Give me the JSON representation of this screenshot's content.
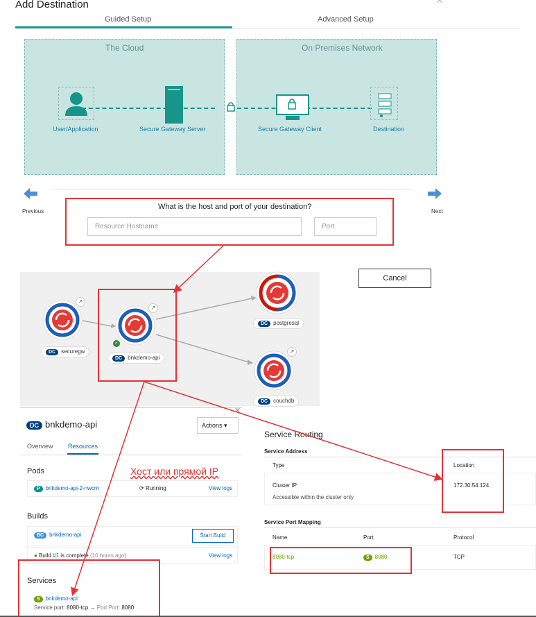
{
  "dialog": {
    "title": "Add Destination",
    "tabs": [
      {
        "label": "Guided Setup",
        "active": true
      },
      {
        "label": "Advanced Setup",
        "active": false
      }
    ]
  },
  "diagram": {
    "cloud_label": "The Cloud",
    "onprem_label": "On Premises Network",
    "nodes": [
      "User/Application",
      "Secure Gateway Server",
      "Secure Gateway Client",
      "Destination"
    ],
    "previous_label": "Previous",
    "next_label": "Next"
  },
  "form": {
    "question": "What is the host and port of your destination?",
    "hostname_placeholder": "Resource Hostname",
    "port_placeholder": "Port",
    "cancel_label": "Cancel"
  },
  "topology": {
    "nodes": [
      {
        "badge": "DC",
        "name": "securegw"
      },
      {
        "badge": "DC",
        "name": "bnkdemo-api"
      },
      {
        "badge": "DC",
        "name": "postgresql"
      },
      {
        "badge": "DC",
        "name": "couchdb"
      }
    ]
  },
  "panel": {
    "badge": "DC",
    "title": "bnkdemo-api",
    "actions_label": "Actions",
    "tabs": [
      "Overview",
      "Resources"
    ],
    "pods_header": "Pods",
    "pod": {
      "badge": "P",
      "name": "bnkdemo-api-2-nwcrn",
      "status": "Running",
      "view_logs": "View logs"
    },
    "annotation": "Хост или прямой IP",
    "builds_header": "Builds",
    "build": {
      "badge": "BC",
      "name": "bnkdemo-api",
      "start_label": "Start Build",
      "status_prefix": "Build",
      "status_num": "#1",
      "status_text": "is complete",
      "status_time": "(10 hours ago)",
      "view_logs": "View logs"
    },
    "services_header": "Services",
    "service": {
      "badge": "S",
      "name": "bnkdemo-api",
      "service_port_label": "Service port:",
      "service_port": "8080-tcp",
      "pod_port_label": "Pod Port:",
      "pod_port": "8080"
    }
  },
  "routing": {
    "title": "Service Routing",
    "address_header": "Service Address",
    "type_col": "Type",
    "location_col": "Location",
    "type_value": "Cluster IP",
    "type_desc": "Accessible within the cluster only",
    "location_value": "172.30.54.124",
    "mapping_header": "Service Port Mapping",
    "name_col": "Name",
    "port_col": "Port",
    "protocol_col": "Protocol",
    "name_value": "8080-tcp",
    "port_badge": "S",
    "port_value": "8080",
    "protocol_value": "TCP"
  },
  "colors": {
    "accent": "#17958b",
    "annotation_red": "#e63234",
    "link": "#0066cc"
  }
}
